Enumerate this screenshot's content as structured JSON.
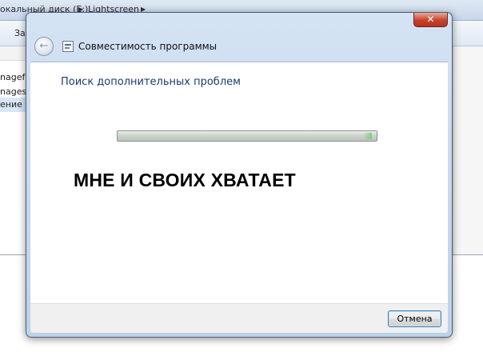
{
  "background_window": {
    "breadcrumb": [
      "окальный диск (E:)",
      "Lightscreen"
    ],
    "toolbar_label": "За",
    "rows": [
      "nagefor",
      "nages",
      "ение"
    ]
  },
  "dialog": {
    "title": "Совместимость программы",
    "close_label": "✕",
    "back_icon": "back-arrow-icon",
    "app_icon": "program-compatibility-icon",
    "status_heading": "Поиск дополнительных проблем",
    "progress": 1.0,
    "overlay_caption": "МНЕ И СВОИХ ХВАТАЕТ",
    "cancel_label": "Отмена"
  },
  "colors": {
    "heading": "#1b3b6e",
    "close_button": "#c7432b",
    "frame": "#bcd1ea"
  }
}
